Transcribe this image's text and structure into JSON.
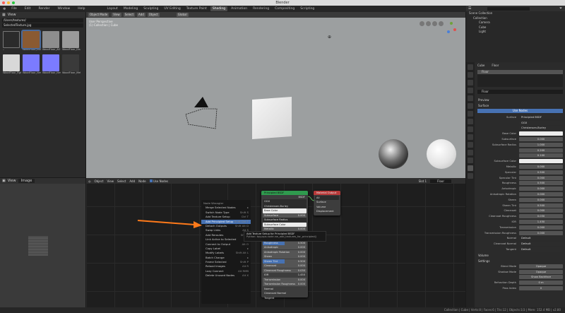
{
  "window": {
    "title": "Blender"
  },
  "menubar": {
    "menus": [
      "File",
      "Edit",
      "Render",
      "Window",
      "Help"
    ],
    "workspaces": [
      "Layout",
      "Modeling",
      "Sculpting",
      "UV Editing",
      "Texture Paint",
      "Shading",
      "Animation",
      "Rendering",
      "Compositing",
      "Scripting"
    ],
    "active_workspace": "Shading",
    "scene": "Scene",
    "view_layer": "View Layer"
  },
  "filebrowser": {
    "view": "View",
    "path": "/Users/textures/",
    "filter": "SelectedTexture.jpg",
    "items": [
      {
        "label": "..",
        "color": "#2b2b2b"
      },
      {
        "label": "WoodFloor_Col",
        "color": "#8a5a32"
      },
      {
        "label": "WoodFloor_AO",
        "color": "#8d8d8d"
      },
      {
        "label": "WoodFloor_Disp",
        "color": "#9a9a9a"
      },
      {
        "label": "WoodFloor_Rgh",
        "color": "#d8d8d8"
      },
      {
        "label": "WoodFloor_Nrm",
        "color": "#7b7bff"
      },
      {
        "label": "WoodFloor_Nrm2",
        "color": "#7b7bff"
      },
      {
        "label": "WoodFloor_Met",
        "color": "#3a3a3a"
      }
    ]
  },
  "viewport": {
    "mode": "Object Mode",
    "menus": [
      "View",
      "Select",
      "Add",
      "Object"
    ],
    "shading": "Global",
    "overlay_title": "User Perspective",
    "overlay_sub": "(1) Collection | Cube"
  },
  "imgeditor": {
    "view": "View",
    "mode": "Image"
  },
  "nodeeditor": {
    "editor": "Object",
    "menus": [
      "View",
      "Select",
      "Add",
      "Node"
    ],
    "use_nodes": "Use Nodes",
    "slot": "Slot 1",
    "material": "Floor"
  },
  "bsdf_node": {
    "title": "Principled BSDF",
    "output": "BSDF",
    "distribution": "GGX",
    "subsurface_method": "Christensen-Burley",
    "rows": [
      {
        "label": "Base Color",
        "value": "",
        "kind": "white"
      },
      {
        "label": "Subsurface",
        "value": "0.000"
      },
      {
        "label": "Subsurface Radius",
        "value": "",
        "kind": "dd"
      },
      {
        "label": "Subsurface Color",
        "value": "",
        "kind": "white"
      },
      {
        "label": "Metallic",
        "value": "0.000"
      },
      {
        "label": "Specular",
        "value": "0.500",
        "kind": "blue"
      },
      {
        "label": "Specular Tint",
        "value": "0.000"
      },
      {
        "label": "Roughness",
        "value": "0.500",
        "kind": "blue"
      },
      {
        "label": "Anisotropic",
        "value": "0.000"
      },
      {
        "label": "Anisotropic Rotation",
        "value": "0.000"
      },
      {
        "label": "Sheen",
        "value": "0.000"
      },
      {
        "label": "Sheen Tint",
        "value": "0.500",
        "kind": "blue"
      },
      {
        "label": "Clearcoat",
        "value": "0.000"
      },
      {
        "label": "Clearcoat Roughness",
        "value": "0.030"
      },
      {
        "label": "IOR",
        "value": "1.450",
        "kind": "plain"
      },
      {
        "label": "Transmission",
        "value": "0.000"
      },
      {
        "label": "Transmission Roughness",
        "value": "0.000"
      },
      {
        "label": "Normal",
        "value": "",
        "kind": "plain"
      },
      {
        "label": "Clearcoat Normal",
        "value": "",
        "kind": "plain"
      },
      {
        "label": "Tangent",
        "value": "",
        "kind": "plain"
      }
    ]
  },
  "output_node": {
    "title": "Material Output",
    "target": "All",
    "sockets": [
      "Surface",
      "Volume",
      "Displacement"
    ]
  },
  "context_menu": {
    "title": "Node Wrangler",
    "items": [
      {
        "label": "Merge Selected Nodes",
        "shortcut": "▸"
      },
      {
        "label": "Switch Node Type",
        "shortcut": "Shift S"
      },
      {
        "label": "Add Texture Setup",
        "shortcut": "Ctrl T"
      },
      {
        "label": "Add Principled Setup",
        "shortcut": "Shift Ctrl T",
        "hl": true
      },
      {
        "label": "Detach Outputs",
        "shortcut": "Shift Alt D"
      },
      {
        "label": "Swap Links",
        "shortcut": "Alt S"
      },
      {
        "label": "Add Reroutes",
        "shortcut": "Shift /"
      },
      {
        "label": "Link Active to Selected",
        "shortcut": "▸"
      },
      {
        "label": "Connect to Output",
        "shortcut": "Alt O"
      },
      {
        "label": "Copy Label",
        "shortcut": "▸"
      },
      {
        "label": "Modify Labels",
        "shortcut": "Shift Alt L"
      },
      {
        "label": "Batch Change",
        "shortcut": "▸"
      },
      {
        "label": "Frame Selected",
        "shortcut": "Shift P"
      },
      {
        "label": "Reload Images",
        "shortcut": "Alt R"
      },
      {
        "label": "Lazy Connect",
        "shortcut": "Alt RMB"
      },
      {
        "label": "Delete Unused Nodes",
        "shortcut": "Alt X"
      }
    ]
  },
  "tooltip": {
    "title": "Add Texture Setup for Principled BSDF",
    "body": "Python: bpy.ops.node.nw_add_textures_for_principled()"
  },
  "outliner": {
    "root": "Scene Collection",
    "items": [
      "Collection",
      "Camera",
      "Cube",
      "Light"
    ]
  },
  "properties": {
    "object": "Cube",
    "material": "Floor",
    "slot": "Floor",
    "section_preview": "Preview",
    "section_surface": "Surface",
    "use_nodes": "Use Nodes",
    "rows": [
      {
        "label": "Surface",
        "value": "Principled BSDF",
        "kind": "dd"
      },
      {
        "label": "",
        "value": "GGX",
        "kind": "dd"
      },
      {
        "label": "",
        "value": "Christensen-Burley",
        "kind": "dd"
      },
      {
        "label": "Base Color",
        "value": "",
        "kind": "white"
      },
      {
        "label": "Subsurface",
        "value": "0.000"
      },
      {
        "label": "Subsurface Radius",
        "value": "1.000"
      },
      {
        "label": "",
        "value": "0.200"
      },
      {
        "label": "",
        "value": "0.100"
      },
      {
        "label": "Subsurface Color",
        "value": "",
        "kind": "white"
      },
      {
        "label": "Metallic",
        "value": "0.000"
      },
      {
        "label": "Specular",
        "value": "0.500"
      },
      {
        "label": "Specular Tint",
        "value": "0.000"
      },
      {
        "label": "Roughness",
        "value": "0.500"
      },
      {
        "label": "Anisotropic",
        "value": "0.000"
      },
      {
        "label": "Anisotropic Rotation",
        "value": "0.000"
      },
      {
        "label": "Sheen",
        "value": "0.000"
      },
      {
        "label": "Sheen Tint",
        "value": "0.500"
      },
      {
        "label": "Clearcoat",
        "value": "0.000"
      },
      {
        "label": "Clearcoat Roughness",
        "value": "0.030"
      },
      {
        "label": "IOR",
        "value": "1.450"
      },
      {
        "label": "Transmission",
        "value": "0.000"
      },
      {
        "label": "Transmission Roughness",
        "value": "0.000"
      },
      {
        "label": "Normal",
        "value": "Default",
        "kind": "dd"
      },
      {
        "label": "Clearcoat Normal",
        "value": "Default",
        "kind": "dd"
      },
      {
        "label": "Tangent",
        "value": "Default",
        "kind": "dd"
      }
    ],
    "section_volume": "Volume",
    "section_settings": "Settings",
    "settings": [
      {
        "label": "Blend Mode",
        "value": "Opaque"
      },
      {
        "label": "Shadow Mode",
        "value": "Opaque"
      },
      {
        "label": "",
        "value": "Show Backface"
      },
      {
        "label": "Refraction Depth",
        "value": "0 m"
      },
      {
        "label": "Pass Index",
        "value": "0"
      }
    ]
  },
  "statusbar": {
    "text": "Collection | Cube | Verts:8 | Faces:6 | Tris:12 | Objects:1/3 | Mem: 152.4 MB | v2.80"
  }
}
